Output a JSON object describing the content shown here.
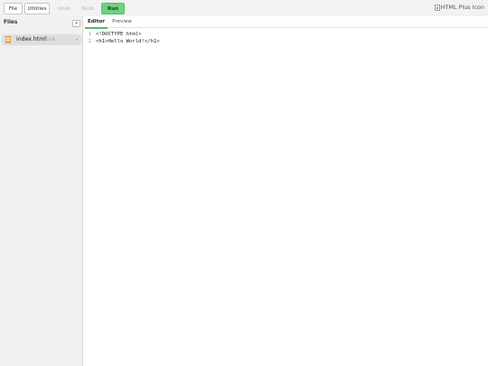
{
  "toolbar": {
    "file_label": "File",
    "utilities_label": "Utilities",
    "undo_label": "Undo",
    "redo_label": "Redo",
    "run_label": "Run",
    "run_color": "#6fd07f",
    "logo_alt": "HTML Plus Icon"
  },
  "sidebar": {
    "title": "Files",
    "add_button": "+",
    "files": [
      {
        "name": "index.html",
        "size": "53 B",
        "menu": "▾",
        "icon": "html-file-icon"
      }
    ]
  },
  "editor": {
    "tabs": [
      {
        "label": "Editor",
        "active": true
      },
      {
        "label": "Preview",
        "active": false
      }
    ],
    "lines": [
      {
        "number": "1",
        "text": "<!DOCTYPE html>"
      },
      {
        "number": "2",
        "text": "<h1>Hello World!</h1>"
      }
    ],
    "accent": "#58b868"
  }
}
